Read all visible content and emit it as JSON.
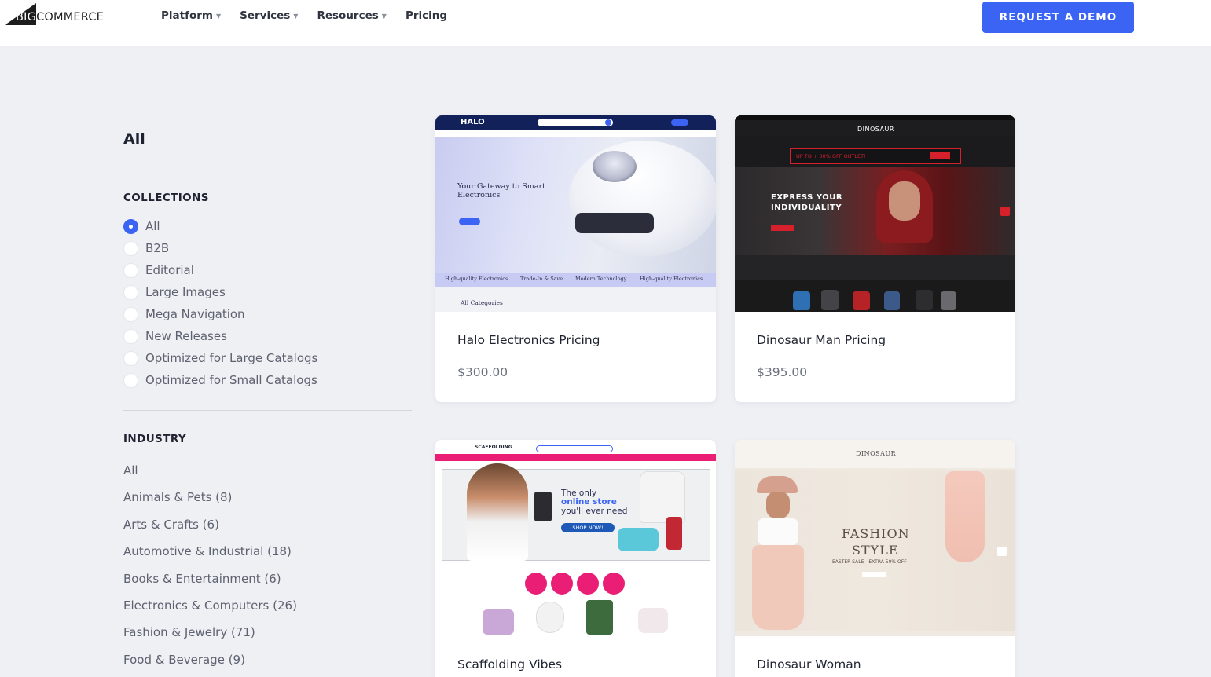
{
  "header": {
    "logo": {
      "big": "BIG",
      "commerce": "COMMERCE"
    },
    "nav": [
      {
        "label": "Platform",
        "has_caret": true
      },
      {
        "label": "Services",
        "has_caret": true
      },
      {
        "label": "Resources",
        "has_caret": true
      },
      {
        "label": "Pricing",
        "has_caret": false
      }
    ],
    "cta_label": "REQUEST A DEMO"
  },
  "sidebar": {
    "title": "All",
    "collections_label": "COLLECTIONS",
    "collections": [
      {
        "label": "All",
        "checked": true
      },
      {
        "label": "B2B",
        "checked": false
      },
      {
        "label": "Editorial",
        "checked": false
      },
      {
        "label": "Large Images",
        "checked": false
      },
      {
        "label": "Mega Navigation",
        "checked": false
      },
      {
        "label": "New Releases",
        "checked": false
      },
      {
        "label": "Optimized for Large Catalogs",
        "checked": false
      },
      {
        "label": "Optimized for Small Catalogs",
        "checked": false
      }
    ],
    "industry_label": "INDUSTRY",
    "industries": [
      "All",
      "Animals & Pets (8)",
      "Arts & Crafts (6)",
      "Automotive & Industrial (18)",
      "Books & Entertainment (6)",
      "Electronics & Computers (26)",
      "Fashion & Jewelry (71)",
      "Food & Beverage (9)"
    ]
  },
  "cards": [
    {
      "name": "Halo Electronics Pricing",
      "price": "$300.00",
      "thumb": {
        "brand": "HALO",
        "headline": "Your Gateway to Smart Electronics",
        "strip": [
          "High-quality Electronics",
          "Trade-In & Save",
          "Modern Technology",
          "High-quality Electronics"
        ],
        "footer": "All Categories"
      }
    },
    {
      "name": "Dinosaur Man Pricing",
      "price": "$395.00",
      "thumb": {
        "brand": "DINOSAUR",
        "promo": "UP TO + 30% OFF OUTLET!",
        "headline": "EXPRESS YOUR INDIVIDUALITY"
      }
    },
    {
      "name": "Scaffolding Vibes",
      "price": "",
      "thumb": {
        "brand": "SCAFFOLDING",
        "line1": "The only",
        "line2": "online store",
        "line3": "you'll ever need",
        "cta": "SHOP NOW!"
      }
    },
    {
      "name": "Dinosaur Woman",
      "price": "",
      "thumb": {
        "brand": "DINOSAUR",
        "headline1": "FASHION",
        "headline2": "STYLE",
        "sub": "EASTER SALE - EXTRA 50% OFF"
      }
    }
  ],
  "colors": {
    "accent": "#3c64f4",
    "background": "#eef0f4",
    "halo_navy": "#12215a",
    "scaffolding_pink": "#e91e74"
  }
}
